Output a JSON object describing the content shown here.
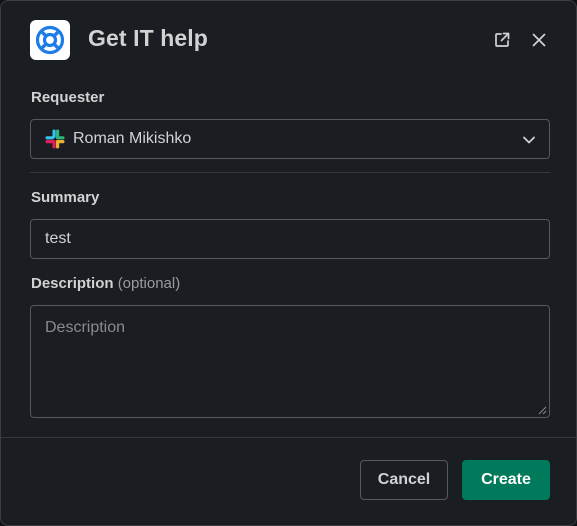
{
  "modal": {
    "title": "Get IT help",
    "app_icon": "lifebuoy-icon",
    "header_actions": [
      "external-link-icon",
      "close-icon"
    ]
  },
  "form": {
    "requester": {
      "label": "Requester",
      "value": "Roman Mikishko",
      "avatar_icon": "slack-logo-icon"
    },
    "summary": {
      "label": "Summary",
      "value": "test"
    },
    "description": {
      "label": "Description",
      "optional_label": "(optional)",
      "placeholder": "Description"
    }
  },
  "footer": {
    "cancel_label": "Cancel",
    "create_label": "Create"
  },
  "colors": {
    "background": "#1a1d21",
    "text": "#d1d2d3",
    "border": "#55585d",
    "primary": "#007a5a",
    "app_icon_blue": "#1d7ce8"
  }
}
